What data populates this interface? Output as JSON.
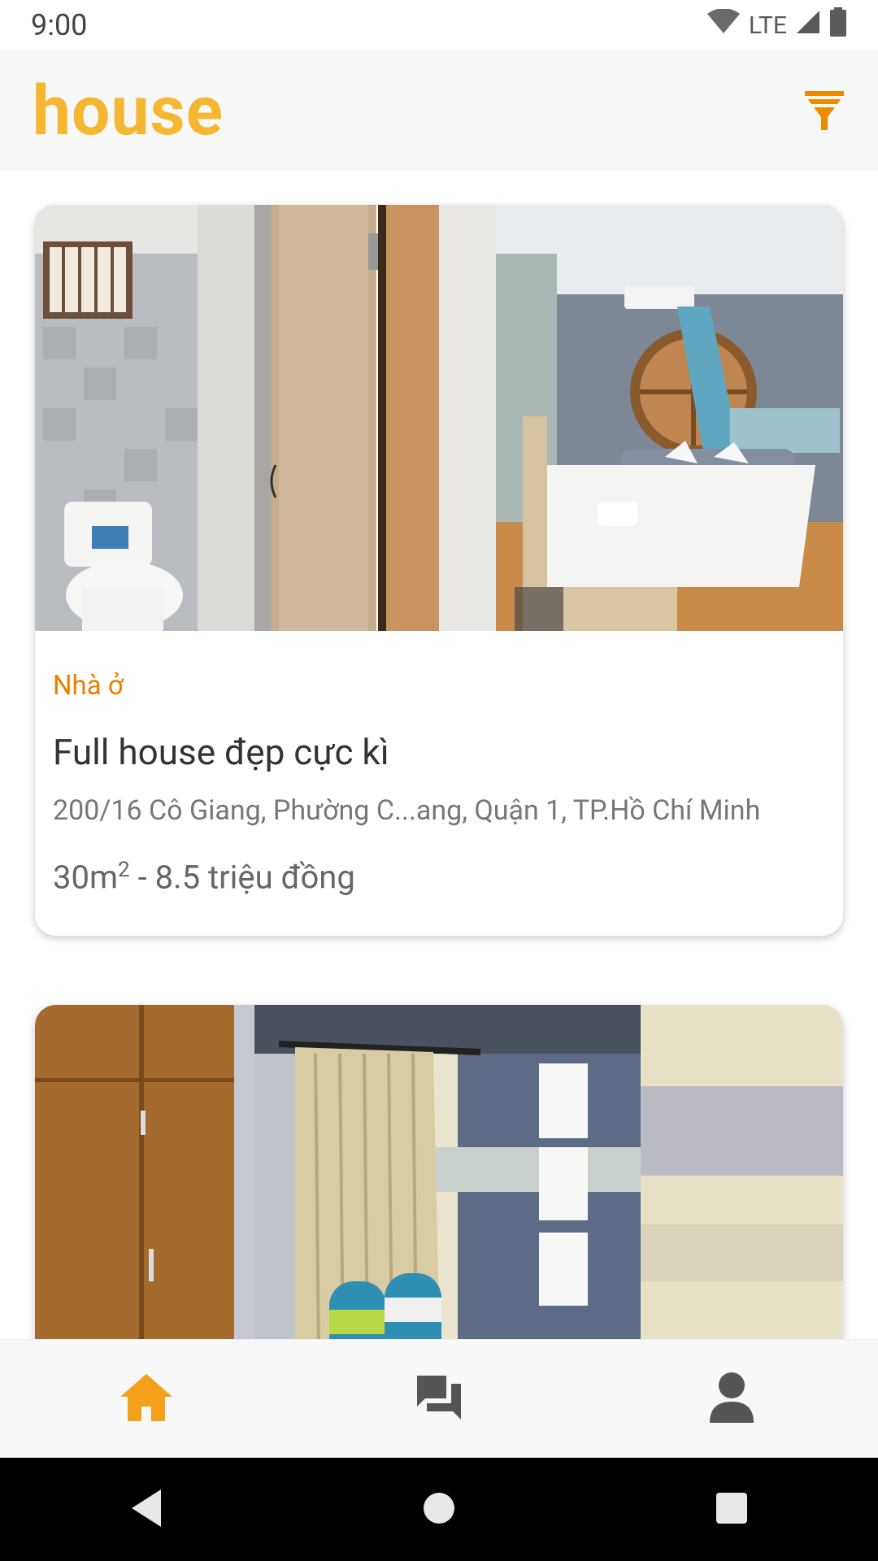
{
  "status_bar": {
    "time": "9:00",
    "network": "LTE"
  },
  "app_bar": {
    "title": "house",
    "filter_icon": "filter-icon"
  },
  "listings": [
    {
      "category": "Nhà ở",
      "title": "Full house đẹp cực kì",
      "address": "200/16 Cô Giang, Phường C...ang, Quận 1, TP.Hồ Chí Minh",
      "area_value": "30m",
      "area_exp": "2",
      "price_rest": " - 8.5 triệu đồng"
    },
    {
      "category": "",
      "title": "",
      "address": "",
      "area_value": "",
      "area_exp": "",
      "price_rest": ""
    }
  ],
  "bottom_nav": [
    {
      "icon": "home-icon",
      "active": true
    },
    {
      "icon": "chat-icon",
      "active": false
    },
    {
      "icon": "profile-icon",
      "active": false
    }
  ],
  "colors": {
    "brand": "#f5b731",
    "accent": "#ef7d00",
    "icon_inactive": "#555555"
  }
}
